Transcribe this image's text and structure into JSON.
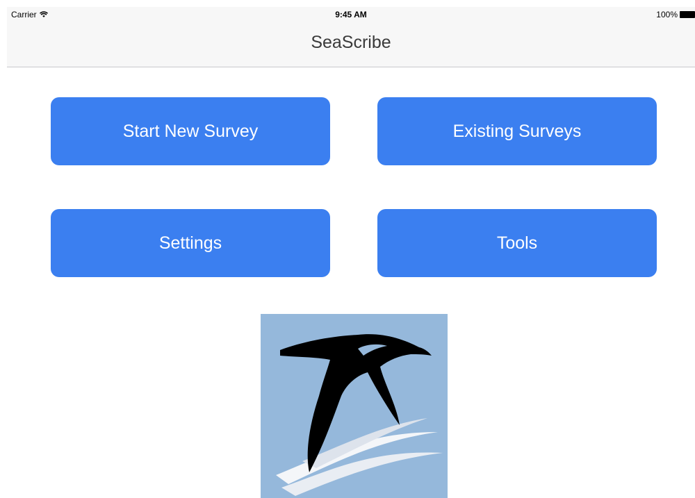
{
  "status_bar": {
    "carrier": "Carrier",
    "time": "9:45 AM",
    "battery": "100%"
  },
  "nav_bar": {
    "title": "SeaScribe"
  },
  "menu": {
    "start_new_survey": "Start New Survey",
    "existing_surveys": "Existing Surveys",
    "settings": "Settings",
    "tools": "Tools"
  },
  "colors": {
    "button": "#3b7ff0",
    "button_text": "#ffffff",
    "nav_background": "#f7f7f7",
    "logo_background": "#95b8db"
  },
  "icons": {
    "wifi": "wifi-icon",
    "battery": "battery-icon",
    "logo": "seabird-over-waves-logo"
  }
}
